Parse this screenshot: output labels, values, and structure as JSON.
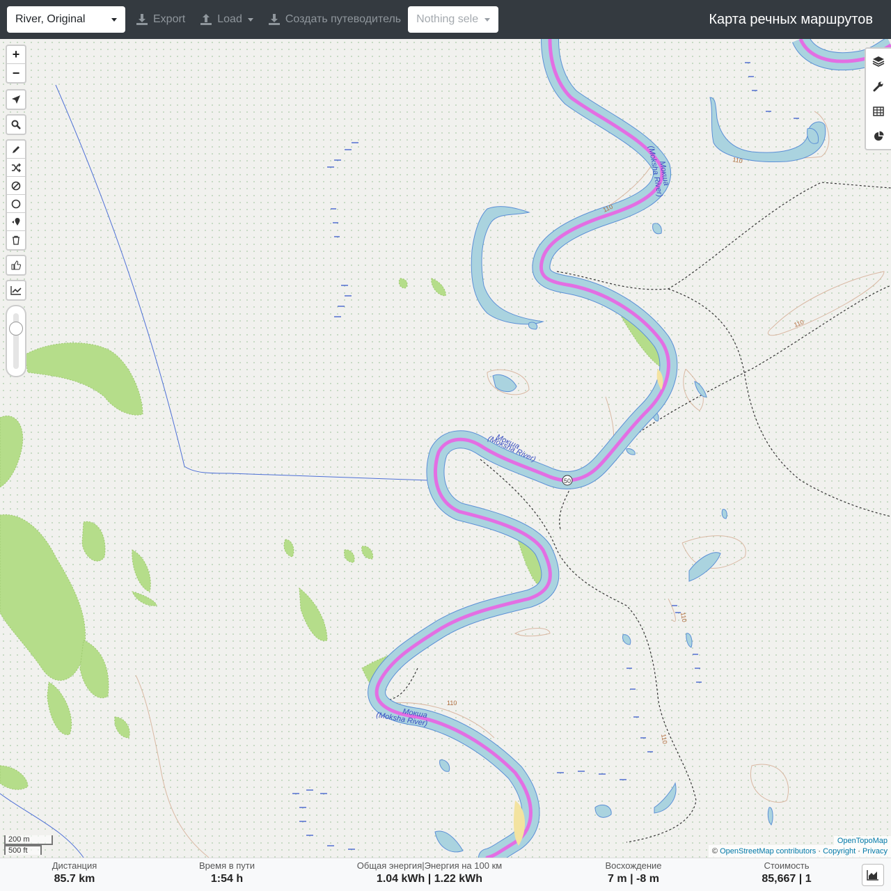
{
  "toolbar": {
    "profile_value": "River, Original",
    "export_label": "Export",
    "load_label": "Load",
    "guide_label": "Создать путеводитель",
    "track_select_placeholder": "Nothing sele",
    "app_title": "Карта речных маршрутов"
  },
  "map": {
    "zoom_in": "+",
    "zoom_out": "−",
    "labels": {
      "river_name_1": "Мокша",
      "river_name_1_en": "(Moksha River)",
      "river_name_2": "Мокша",
      "river_name_2_en": "(Moksha River)",
      "river_name_3": "Мокша",
      "river_name_3_en": "(Moksha River)",
      "contour_110_a": "110",
      "contour_110_b": "110",
      "contour_110_c": "110",
      "contour_110_d": "110",
      "contour_110_e": "110",
      "contour_110_f": "110",
      "km_marker": "50"
    },
    "scale_metric": "200 m",
    "scale_imperial": "500 ft",
    "attribution_opentopomap": "OpenTopoMap",
    "attribution_prefix": "©",
    "attribution_osm": "OpenStreetMap contributors",
    "attribution_sep1": "·",
    "attribution_copyright": "Copyright",
    "attribution_sep2": "·",
    "attribution_privacy": "Privacy",
    "colors": {
      "water": "#aad3df",
      "water_edge": "#5b8fd6",
      "route": "#e36ee3",
      "forest": "#b5dd8a",
      "contour": "#d0a58a"
    }
  },
  "stats": {
    "distance_label": "Дистанция",
    "distance_value": "85.7",
    "distance_unit": "km",
    "time_label": "Время в пути",
    "time_value": "1:54",
    "time_unit": "h",
    "energy_label": "Общая энергия|Энергия на 100 км",
    "energy_value": "1.04",
    "energy_unit": "kWh",
    "energy_sep": "|",
    "energy100_value": "1.22",
    "energy100_unit": "kWh",
    "ascent_label": "Восхождение",
    "ascent_value": "7",
    "ascent_unit": "m",
    "ascent_sep": "|",
    "descent_value": "-8",
    "descent_unit": "m",
    "cost_label": "Стоимость",
    "cost_value": "85,667",
    "cost_sep": "|",
    "cost_count": "1"
  }
}
